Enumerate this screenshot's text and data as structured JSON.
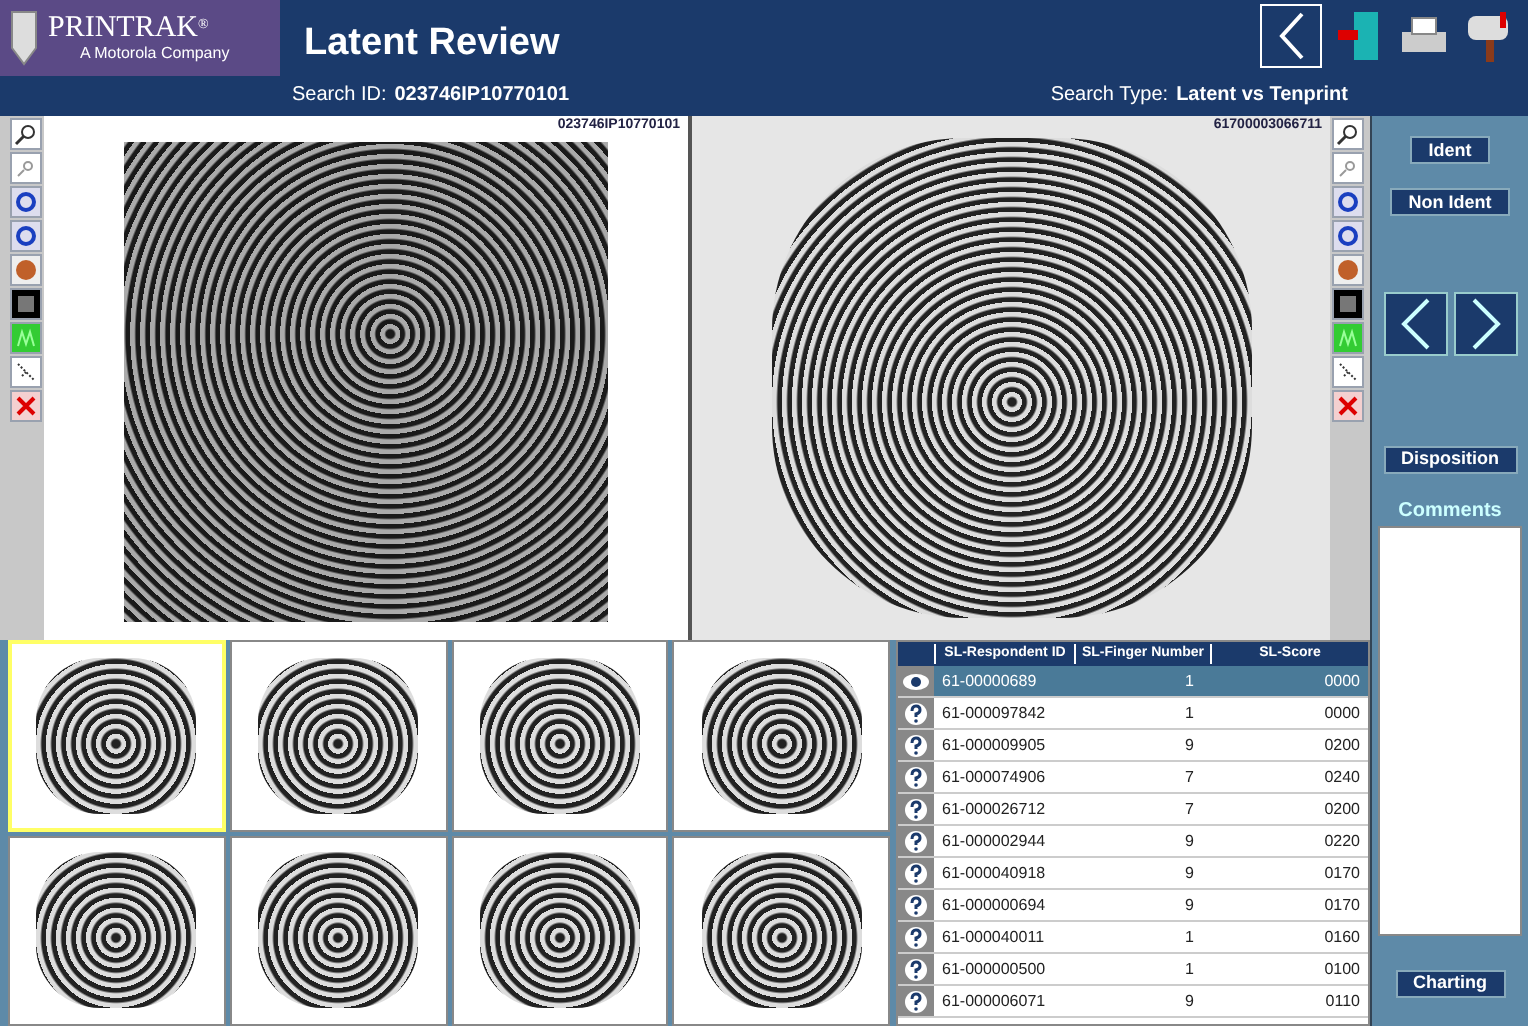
{
  "header": {
    "logo_name": "PRINTRAK",
    "logo_mark": "®",
    "logo_tagline": "A Motorola Company",
    "title": "Latent Review",
    "search_id_label": "Search ID:",
    "search_id": "023746IP10770101",
    "search_type_label": "Search Type:",
    "search_type": "Latent vs Tenprint"
  },
  "left_image": {
    "caption": "023746IP10770101"
  },
  "right_image": {
    "caption": "61700003066711"
  },
  "actions": {
    "ident": "Ident",
    "non_ident": "Non Ident",
    "disposition": "Disposition",
    "comments_label": "Comments",
    "charting": "Charting"
  },
  "thumbnails": [
    {
      "selected": true
    },
    {
      "selected": false
    },
    {
      "selected": false
    },
    {
      "selected": false
    },
    {
      "selected": false
    },
    {
      "selected": false
    },
    {
      "selected": false
    },
    {
      "selected": false
    }
  ],
  "table": {
    "columns": [
      "SL-Respondent ID",
      "SL-Finger Number",
      "SL-Score"
    ],
    "rows": [
      {
        "selected": true,
        "id": "61-00000689",
        "finger": "1",
        "score": "0000"
      },
      {
        "selected": false,
        "id": "61-000097842",
        "finger": "1",
        "score": "0000"
      },
      {
        "selected": false,
        "id": "61-000009905",
        "finger": "9",
        "score": "0200"
      },
      {
        "selected": false,
        "id": "61-000074906",
        "finger": "7",
        "score": "0240"
      },
      {
        "selected": false,
        "id": "61-000026712",
        "finger": "7",
        "score": "0200"
      },
      {
        "selected": false,
        "id": "61-000002944",
        "finger": "9",
        "score": "0220"
      },
      {
        "selected": false,
        "id": "61-000040918",
        "finger": "9",
        "score": "0170"
      },
      {
        "selected": false,
        "id": "61-000000694",
        "finger": "9",
        "score": "0170"
      },
      {
        "selected": false,
        "id": "61-000040011",
        "finger": "1",
        "score": "0160"
      },
      {
        "selected": false,
        "id": "61-000000500",
        "finger": "1",
        "score": "0100"
      },
      {
        "selected": false,
        "id": "61-000006071",
        "finger": "9",
        "score": "0110"
      }
    ]
  }
}
